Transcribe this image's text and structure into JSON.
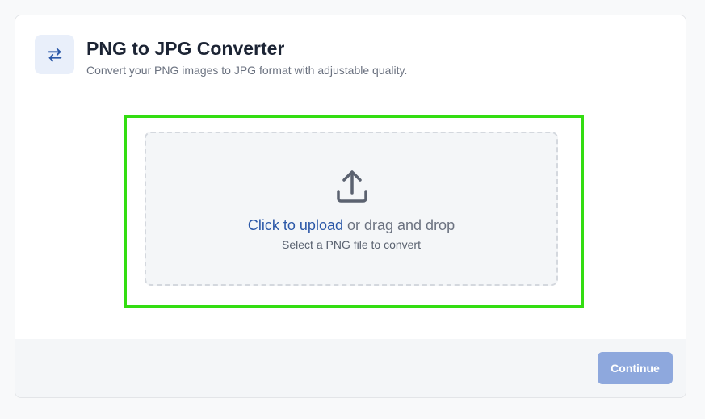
{
  "header": {
    "icon": "swap-arrows-icon",
    "title": "PNG to JPG Converter",
    "subtitle": "Convert your PNG images to JPG format with adjustable quality."
  },
  "dropzone": {
    "icon": "upload-icon",
    "link_text": "Click to upload",
    "rest_text": " or drag and drop",
    "hint": "Select a PNG file to convert"
  },
  "footer": {
    "continue_label": "Continue",
    "continue_disabled": true
  },
  "colors": {
    "accent": "#2b58a8",
    "button_disabled": "#8ea8dd",
    "highlight": "#33dd11",
    "icon_badge_bg": "#e9effa"
  }
}
